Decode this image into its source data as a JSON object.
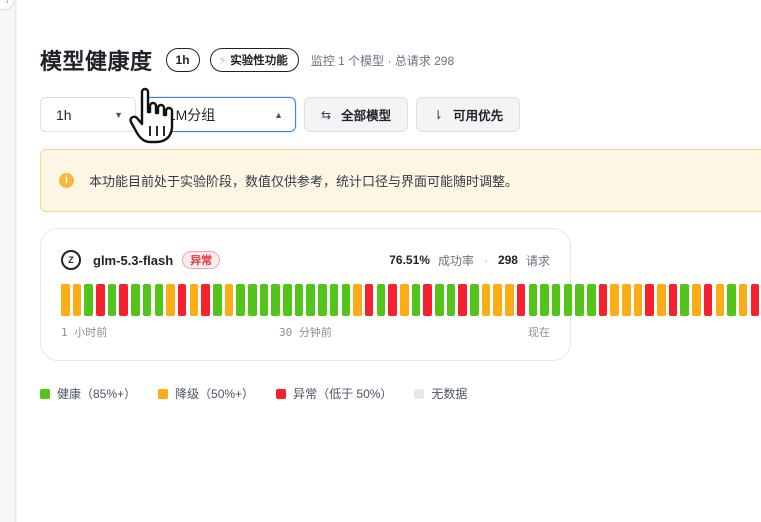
{
  "colors": {
    "healthy": "#52c41a",
    "degraded": "#faad14",
    "abnormal": "#f5222d",
    "nodata": "#e5e7eb"
  },
  "header": {
    "title": "模型健康度",
    "range_badge": "1h",
    "experimental_badge": "实验性功能",
    "meta": "监控 1 个模型 · 总请求 298"
  },
  "controls": {
    "range_value": "1h",
    "group_value": "LLM分组",
    "all_models_label": "全部模型",
    "sort_label": "可用优先"
  },
  "notice": {
    "text": "本功能目前处于实验阶段，数值仅供参考，统计口径与界面可能随时调整。"
  },
  "model_card": {
    "logo_text": "Z",
    "name": "glm-5.3-flash",
    "status": "异常",
    "success_rate": "76.51%",
    "success_label": "成功率",
    "separator": "·",
    "requests": "298",
    "requests_label": "请求",
    "buckets": [
      "degraded",
      "degraded",
      "healthy",
      "abnormal",
      "healthy",
      "abnormal",
      "healthy",
      "healthy",
      "healthy",
      "degraded",
      "abnormal",
      "degraded",
      "abnormal",
      "healthy",
      "degraded",
      "healthy",
      "healthy",
      "healthy",
      "healthy",
      "healthy",
      "healthy",
      "healthy",
      "healthy",
      "healthy",
      "healthy",
      "degraded",
      "abnormal",
      "healthy",
      "abnormal",
      "degraded",
      "healthy",
      "abnormal",
      "healthy",
      "healthy",
      "abnormal",
      "healthy",
      "degraded",
      "degraded",
      "degraded",
      "abnormal",
      "healthy",
      "healthy",
      "healthy",
      "healthy",
      "healthy",
      "healthy",
      "abnormal",
      "degraded",
      "degraded",
      "degraded",
      "abnormal",
      "degraded",
      "abnormal",
      "healthy",
      "degraded",
      "abnormal",
      "degraded",
      "healthy",
      "degraded",
      "abnormal"
    ],
    "timeline": {
      "start": "1 小时前",
      "middle": "30 分钟前",
      "end": "现在"
    }
  },
  "legend": {
    "healthy": "健康（85%+）",
    "degraded": "降级（50%+）",
    "abnormal": "异常（低于 50%）",
    "nodata": "无数据"
  }
}
